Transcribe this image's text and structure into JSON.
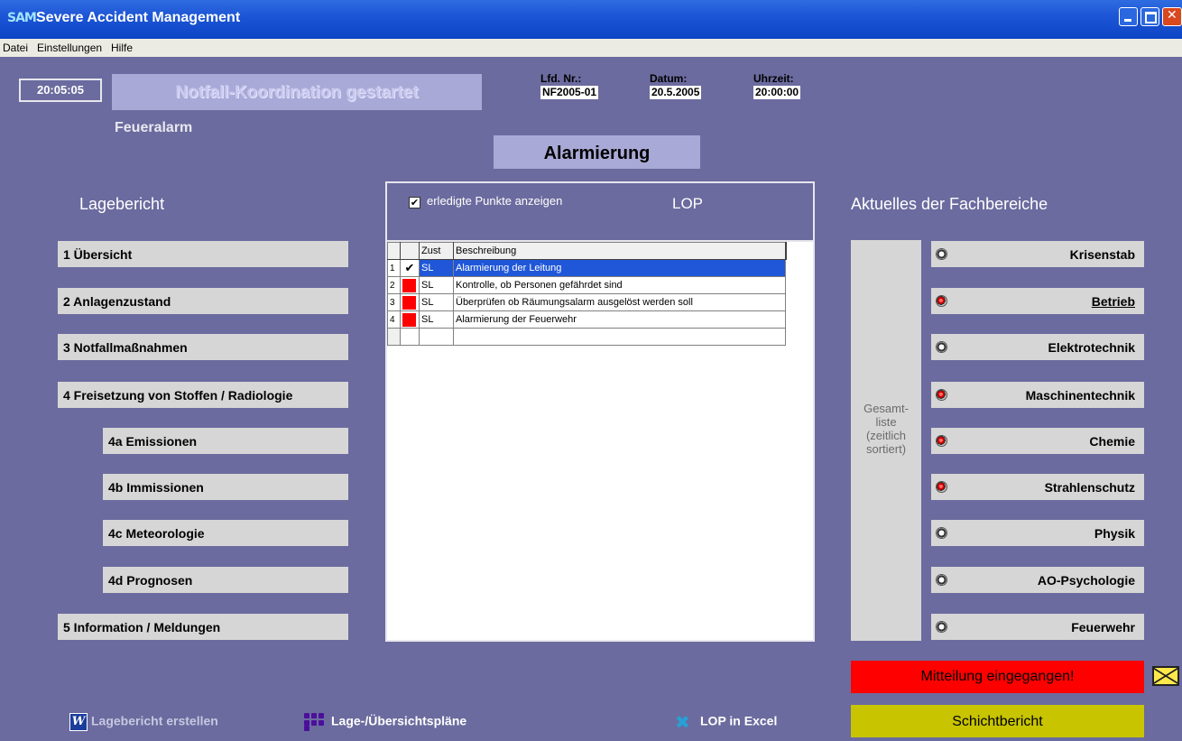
{
  "window": {
    "logo": "SAM",
    "title": "Severe Accident Management"
  },
  "menu": {
    "items": [
      "Datei",
      "Einstellungen",
      "Hilfe"
    ]
  },
  "header": {
    "clock": "20:05:05",
    "status": "Notfall-Koordination gestartet",
    "incident": "Feueralarm",
    "lfd_label": "Lfd. Nr.:",
    "lfd_value": "NF2005-01",
    "datum_label": "Datum:",
    "datum_value": "20.5.2005",
    "uhrzeit_label": "Uhrzeit:",
    "uhrzeit_value": "20:00:00",
    "section_title": "Alarmierung"
  },
  "lagebericht": {
    "title": "Lagebericht",
    "items": [
      "1 Übersicht",
      "2 Anlagenzustand",
      "3 Notfallmaßnahmen",
      "4 Freisetzung von Stoffen / Radiologie",
      "4a Emissionen",
      "4b Immissionen",
      "4c Meteorologie",
      "4d Prognosen",
      "5 Information / Meldungen"
    ]
  },
  "lop": {
    "title": "LOP",
    "show_done_label": "erledigte Punkte anzeigen",
    "show_done_checked": true,
    "columns": [
      "",
      "",
      "Zust",
      "Beschreibung"
    ],
    "rows": [
      {
        "nr": "1",
        "status": "done",
        "zust": "SL",
        "beschreibung": "Alarmierung der Leitung",
        "selected": true
      },
      {
        "nr": "2",
        "status": "open",
        "zust": "SL",
        "beschreibung": "Kontrolle, ob Personen gefährdet sind",
        "selected": false
      },
      {
        "nr": "3",
        "status": "open",
        "zust": "SL",
        "beschreibung": "Überprüfen ob Räumungsalarm ausgelöst werden soll",
        "selected": false
      },
      {
        "nr": "4",
        "status": "open",
        "zust": "SL",
        "beschreibung": "Alarmierung der Feuerwehr",
        "selected": false
      }
    ]
  },
  "fachbereiche": {
    "title": "Aktuelles der Fachbereiche",
    "gesamt_label": "Gesamt-\nliste\n(zeitlich\nsortiert)",
    "items": [
      {
        "label": "Krisenstab",
        "active": false
      },
      {
        "label": "Betrieb",
        "active": true
      },
      {
        "label": "Elektrotechnik",
        "active": false
      },
      {
        "label": "Maschinentechnik",
        "active": true
      },
      {
        "label": "Chemie",
        "active": true
      },
      {
        "label": "Strahlenschutz",
        "active": true
      },
      {
        "label": "Physik",
        "active": false
      },
      {
        "label": "AO-Psychologie",
        "active": false
      },
      {
        "label": "Feuerwehr",
        "active": false
      }
    ]
  },
  "alerts": {
    "mitteilung": "Mitteilung eingegangen!",
    "schichtbericht": "Schichtbericht"
  },
  "bottom": {
    "lagebericht_erstellen": "Lagebericht erstellen",
    "lageplaene": "Lage-/Übersichtspläne",
    "lop_excel": "LOP in Excel"
  },
  "colors": {
    "background": "#6b6b9f",
    "selected_row": "#1f57d8",
    "alert_red": "#ff0000",
    "schicht_yellow": "#c8c400"
  }
}
